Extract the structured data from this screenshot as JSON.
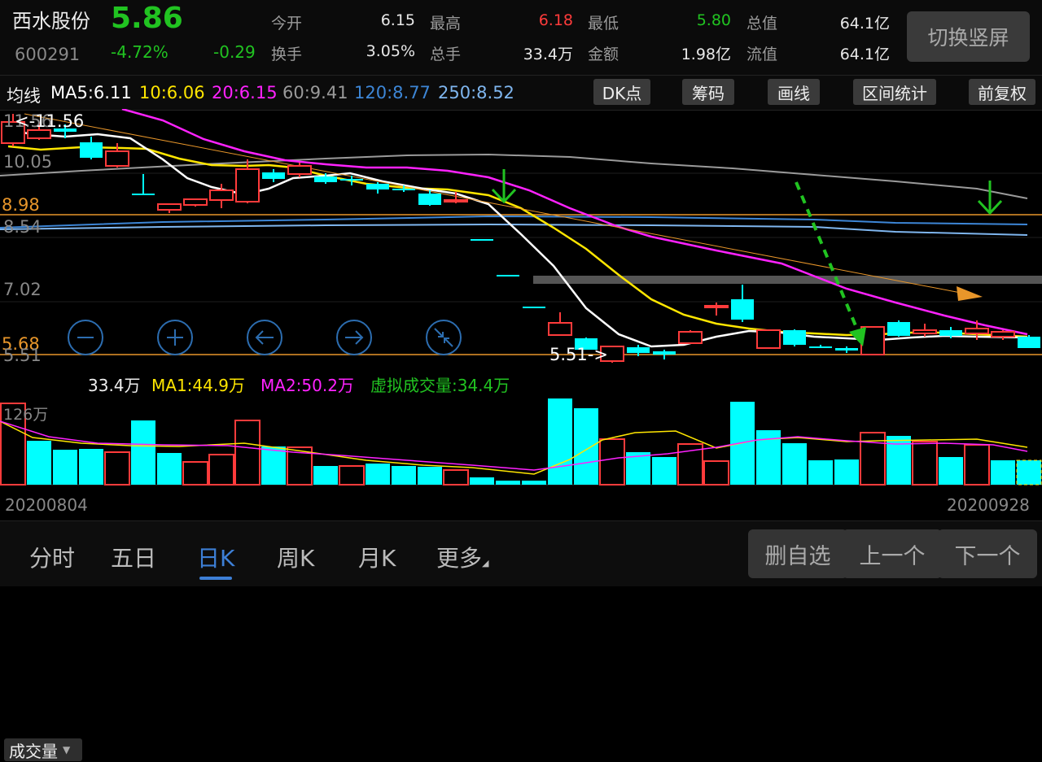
{
  "stock": {
    "name": "西水股份",
    "code": "600291",
    "price": "5.86",
    "change_pct": "-4.72%",
    "change": "-0.29"
  },
  "quote": {
    "open_label": "今开",
    "open": "6.15",
    "high_label": "最高",
    "high": "6.18",
    "low_label": "最低",
    "low": "5.80",
    "mcap_label": "总值",
    "mcap": "64.1亿",
    "turnover_label": "换手",
    "turnover": "3.05%",
    "vol_label": "总手",
    "vol": "33.4万",
    "amount_label": "金额",
    "amount": "1.98亿",
    "float_label": "流值",
    "float": "64.1亿"
  },
  "switch_button": "切换竖屏",
  "ma_bar": {
    "title": "均线",
    "ma5": "MA5:6.11",
    "ma10": "10:6.06",
    "ma20": "20:6.15",
    "ma60": "60:9.41",
    "ma120": "120:8.77",
    "ma250": "250:8.52",
    "buttons": [
      "DK点",
      "筹码",
      "画线",
      "区间统计",
      "前复权"
    ]
  },
  "price_axis": {
    "labels": [
      "11.56",
      "10.05",
      "8.98",
      "8.54",
      "7.02",
      "5.68",
      "5.51"
    ],
    "high_marker": "<-11.56",
    "low_marker": "5.51->"
  },
  "volume_bar": {
    "selector": "成交量",
    "current": "33.4万",
    "ma1": "MA1:44.9万",
    "ma2": "MA2:50.2万",
    "virtual": "虚拟成交量:34.4万",
    "max_label": "126万"
  },
  "dates": {
    "start": "20200804",
    "end": "20200928"
  },
  "nav": {
    "tabs": [
      "分时",
      "五日",
      "日K",
      "周K",
      "月K",
      "更多"
    ],
    "active_index": 2
  },
  "actions": {
    "remove": "删自选",
    "prev": "上一个",
    "next": "下一个"
  },
  "colors": {
    "up": "#ff3b3b",
    "down": "#00ffff",
    "ma5": "#ffffff",
    "ma10": "#ffe600",
    "ma20": "#ff22ff",
    "ma60": "#9a9a9a",
    "ma120": "#3d86d6",
    "ma250": "#7fb6ef",
    "accent": "#3d7fd6"
  }
}
